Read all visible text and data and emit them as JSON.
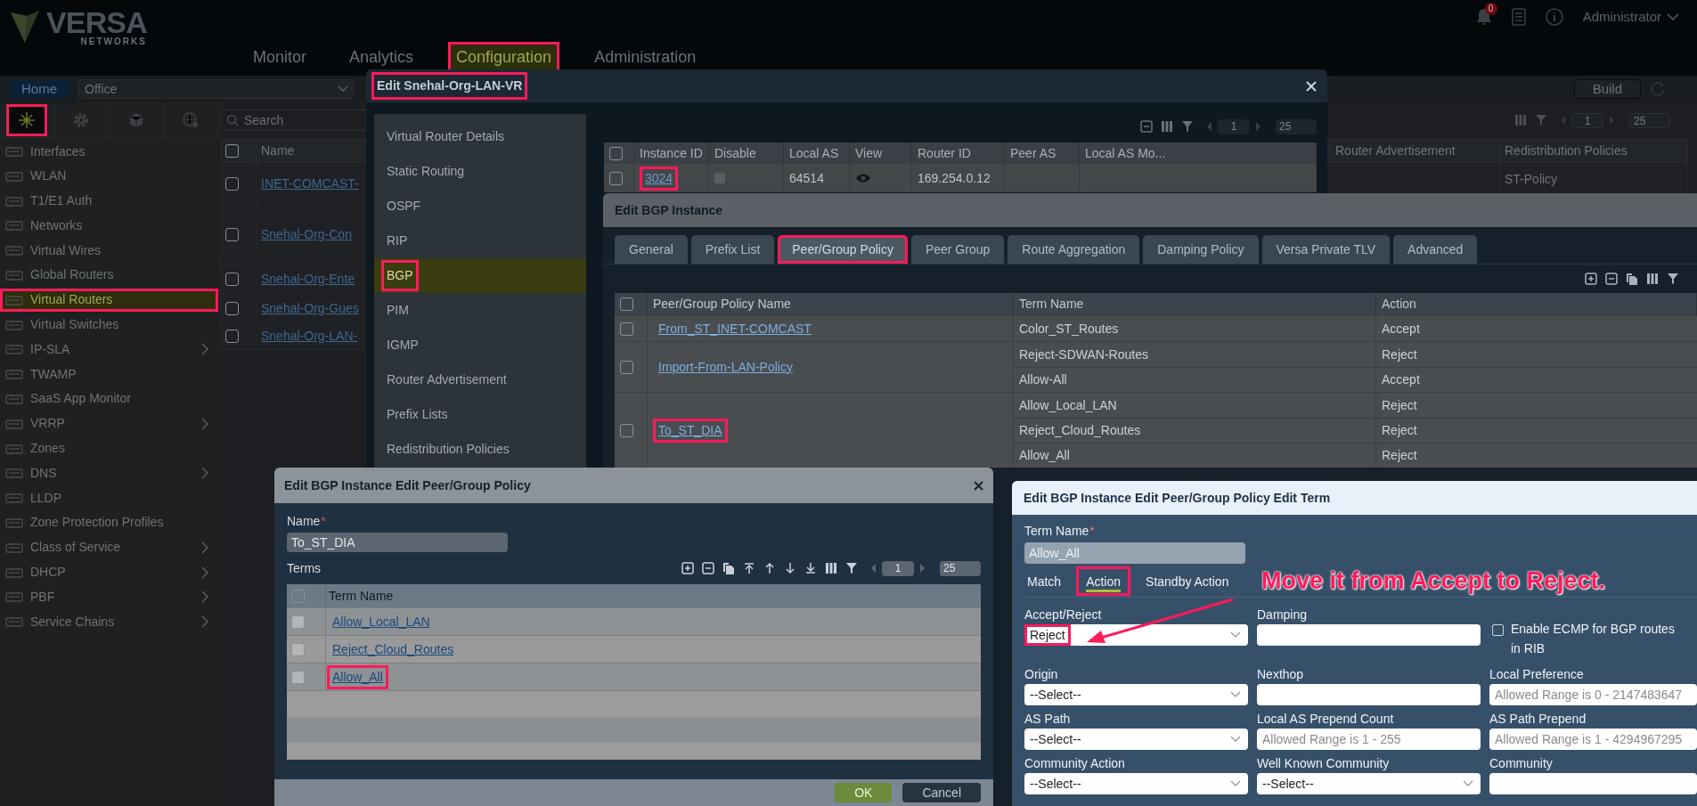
{
  "header": {
    "logo": "VERSA",
    "logo_sub": "NETWORKS",
    "notification_count": "0",
    "user": "Administrator",
    "nav": [
      {
        "label": "Monitor",
        "selected": false,
        "highlighted": false
      },
      {
        "label": "Analytics",
        "selected": false,
        "highlighted": false
      },
      {
        "label": "Configuration",
        "selected": true,
        "highlighted": true
      },
      {
        "label": "Administration",
        "selected": false,
        "highlighted": false
      }
    ]
  },
  "toolbar": {
    "home": "Home",
    "organization": "Office",
    "build": "Build"
  },
  "sidebar": {
    "icon_tabs": [
      {
        "kind": "network",
        "selected": true,
        "highlighted": true
      },
      {
        "kind": "gear",
        "selected": false,
        "highlighted": false
      },
      {
        "kind": "cube",
        "selected": false,
        "highlighted": false
      },
      {
        "kind": "globe",
        "selected": false,
        "highlighted": false
      }
    ],
    "items": [
      {
        "label": "Interfaces",
        "selected": false,
        "highlighted": false,
        "submenu": false
      },
      {
        "label": "WLAN",
        "selected": false,
        "highlighted": false,
        "submenu": false
      },
      {
        "label": "T1/E1 Auth",
        "selected": false,
        "highlighted": false,
        "submenu": false
      },
      {
        "label": "Networks",
        "selected": false,
        "highlighted": false,
        "submenu": false
      },
      {
        "label": "Virtual Wires",
        "selected": false,
        "highlighted": false,
        "submenu": false
      },
      {
        "label": "Global Routers",
        "selected": false,
        "highlighted": false,
        "submenu": false
      },
      {
        "label": "Virtual Routers",
        "selected": true,
        "highlighted": true,
        "submenu": false
      },
      {
        "label": "Virtual Switches",
        "selected": false,
        "highlighted": false,
        "submenu": false
      },
      {
        "label": "IP-SLA",
        "selected": false,
        "highlighted": false,
        "submenu": true
      },
      {
        "label": "TWAMP",
        "selected": false,
        "highlighted": false,
        "submenu": false
      },
      {
        "label": "SaaS App Monitor",
        "selected": false,
        "highlighted": false,
        "submenu": false
      },
      {
        "label": "VRRP",
        "selected": false,
        "highlighted": false,
        "submenu": true
      },
      {
        "label": "Zones",
        "selected": false,
        "highlighted": false,
        "submenu": false
      },
      {
        "label": "DNS",
        "selected": false,
        "highlighted": false,
        "submenu": true
      },
      {
        "label": "LLDP",
        "selected": false,
        "highlighted": false,
        "submenu": false
      },
      {
        "label": "Zone Protection Profiles",
        "selected": false,
        "highlighted": false,
        "submenu": false
      },
      {
        "label": "Class of Service",
        "selected": false,
        "highlighted": false,
        "submenu": true
      },
      {
        "label": "DHCP",
        "selected": false,
        "highlighted": false,
        "submenu": true
      },
      {
        "label": "PBF",
        "selected": false,
        "highlighted": false,
        "submenu": true
      },
      {
        "label": "Service Chains",
        "selected": false,
        "highlighted": false,
        "submenu": true
      }
    ]
  },
  "main_table": {
    "search_placeholder": "Search",
    "page": "1",
    "page_size": "25",
    "all_checked": false,
    "columns": [
      "Name",
      "Router Advertisement",
      "Redistribution Policies"
    ],
    "rows": [
      {
        "name": "INET-COMCAST-",
        "redistribution": "ST-Policy",
        "checked": false
      },
      {
        "name": "Snehal-Org-Con",
        "checked": false
      },
      {
        "name": "Snehal-Org-Ente",
        "checked": false
      },
      {
        "name": "Snehal-Org-Gues",
        "checked": false
      },
      {
        "name": "Snehal-Org-LAN-",
        "checked": false
      }
    ]
  },
  "vr_modal": {
    "title": "Edit Snehal-Org-LAN-VR",
    "title_highlighted": true,
    "page": "1",
    "page_size": "25",
    "all_checked": false,
    "menu": [
      {
        "label": "Virtual Router Details",
        "selected": false,
        "highlighted": false
      },
      {
        "label": "Static Routing",
        "selected": false,
        "highlighted": false
      },
      {
        "label": "OSPF",
        "selected": false,
        "highlighted": false
      },
      {
        "label": "RIP",
        "selected": false,
        "highlighted": false
      },
      {
        "label": "BGP",
        "selected": true,
        "highlighted": true
      },
      {
        "label": "PIM",
        "selected": false,
        "highlighted": false
      },
      {
        "label": "IGMP",
        "selected": false,
        "highlighted": false
      },
      {
        "label": "Router Advertisement",
        "selected": false,
        "highlighted": false
      },
      {
        "label": "Prefix Lists",
        "selected": false,
        "highlighted": false
      },
      {
        "label": "Redistribution Policies",
        "selected": false,
        "highlighted": false
      }
    ],
    "columns": [
      "Instance ID",
      "Disable",
      "Local AS",
      "View",
      "Router ID",
      "Peer AS",
      "Local AS Mo..."
    ],
    "rows": [
      {
        "instance_id": "3024",
        "highlighted": true,
        "checked": false,
        "disable": false,
        "local_as": "64514",
        "router_id": "169.254.0.12"
      }
    ]
  },
  "bgp_modal": {
    "title": "Edit BGP Instance",
    "all_checked": false,
    "tabs": [
      {
        "label": "General",
        "selected": false,
        "highlighted": false
      },
      {
        "label": "Prefix List",
        "selected": false,
        "highlighted": false
      },
      {
        "label": "Peer/Group Policy",
        "selected": true,
        "highlighted": true
      },
      {
        "label": "Peer Group",
        "selected": false,
        "highlighted": false
      },
      {
        "label": "Route Aggregation",
        "selected": false,
        "highlighted": false
      },
      {
        "label": "Damping Policy",
        "selected": false,
        "highlighted": false
      },
      {
        "label": "Versa Private TLV",
        "selected": false,
        "highlighted": false
      },
      {
        "label": "Advanced",
        "selected": false,
        "highlighted": false
      }
    ],
    "columns": [
      "Peer/Group Policy Name",
      "Term Name",
      "Action"
    ],
    "rows": [
      {
        "policy": "From_ST_INET-COMCAST",
        "highlighted": false,
        "checked": false,
        "terms": [
          {
            "term": "Color_ST_Routes",
            "action": "Accept"
          }
        ]
      },
      {
        "policy": "Import-From-LAN-Policy",
        "highlighted": false,
        "checked": false,
        "terms": [
          {
            "term": "Reject-SDWAN-Routes",
            "action": "Reject"
          },
          {
            "term": "Allow-All",
            "action": "Accept"
          }
        ]
      },
      {
        "policy": "To_ST_DIA",
        "highlighted": true,
        "checked": false,
        "terms": [
          {
            "term": "Allow_Local_LAN",
            "action": "Reject"
          },
          {
            "term": "Reject_Cloud_Routes",
            "action": "Reject"
          },
          {
            "term": "Allow_All",
            "action": "Reject"
          }
        ]
      }
    ]
  },
  "policy_modal": {
    "title": "Edit BGP Instance Edit Peer/Group Policy",
    "name_label": "Name",
    "required_mark": "*",
    "name": "To_ST_DIA",
    "terms_label": "Terms",
    "page": "1",
    "page_size": "25",
    "column": "Term Name",
    "all_checked": false,
    "terms": [
      {
        "name": "Allow_Local_LAN",
        "highlighted": false,
        "checked": false
      },
      {
        "name": "Reject_Cloud_Routes",
        "highlighted": false,
        "checked": false
      },
      {
        "name": "Allow_All",
        "highlighted": true,
        "checked": false
      }
    ],
    "buttons": [
      {
        "label": "OK",
        "kind": "primary"
      },
      {
        "label": "Cancel",
        "kind": "secondary"
      }
    ]
  },
  "term_modal": {
    "title": "Edit BGP Instance Edit Peer/Group Policy Edit Term",
    "term_name_label": "Term Name",
    "required_mark": "*",
    "term_name": "Allow_All",
    "tabs": [
      {
        "label": "Match",
        "selected": false,
        "highlighted": false
      },
      {
        "label": "Action",
        "selected": true,
        "highlighted": true
      },
      {
        "label": "Standby Action",
        "selected": false,
        "highlighted": false
      }
    ],
    "annotation": "Move it from Accept to Reject.",
    "fields": [
      {
        "label": "Accept/Reject",
        "kind": "select",
        "value": "Reject",
        "highlighted": true
      },
      {
        "label": "Damping",
        "kind": "input",
        "highlighted": false
      },
      {
        "label": "Enable ECMP for BGP routes in RIB",
        "kind": "checkbox",
        "checked": false,
        "highlighted": false
      },
      {
        "label": "Origin",
        "kind": "select",
        "value": "--Select--",
        "highlighted": false
      },
      {
        "label": "Nexthop",
        "kind": "input",
        "highlighted": false
      },
      {
        "label": "Local Preference",
        "kind": "input",
        "placeholder": "Allowed Range is 0 - 2147483647",
        "highlighted": false
      },
      {
        "label": "AS Path",
        "kind": "select",
        "value": "--Select--",
        "highlighted": false
      },
      {
        "label": "Local AS Prepend Count",
        "kind": "input",
        "placeholder": "Allowed Range is 1 - 255",
        "highlighted": false
      },
      {
        "label": "AS Path Prepend",
        "kind": "input",
        "placeholder": "Allowed Range is 1 - 4294967295",
        "highlighted": false
      },
      {
        "label": "Community Action",
        "kind": "select",
        "value": "--Select--",
        "highlighted": false
      },
      {
        "label": "Well Known Community",
        "kind": "select",
        "value": "--Select--",
        "highlighted": false
      },
      {
        "label": "Community",
        "kind": "input",
        "highlighted": false
      }
    ]
  }
}
